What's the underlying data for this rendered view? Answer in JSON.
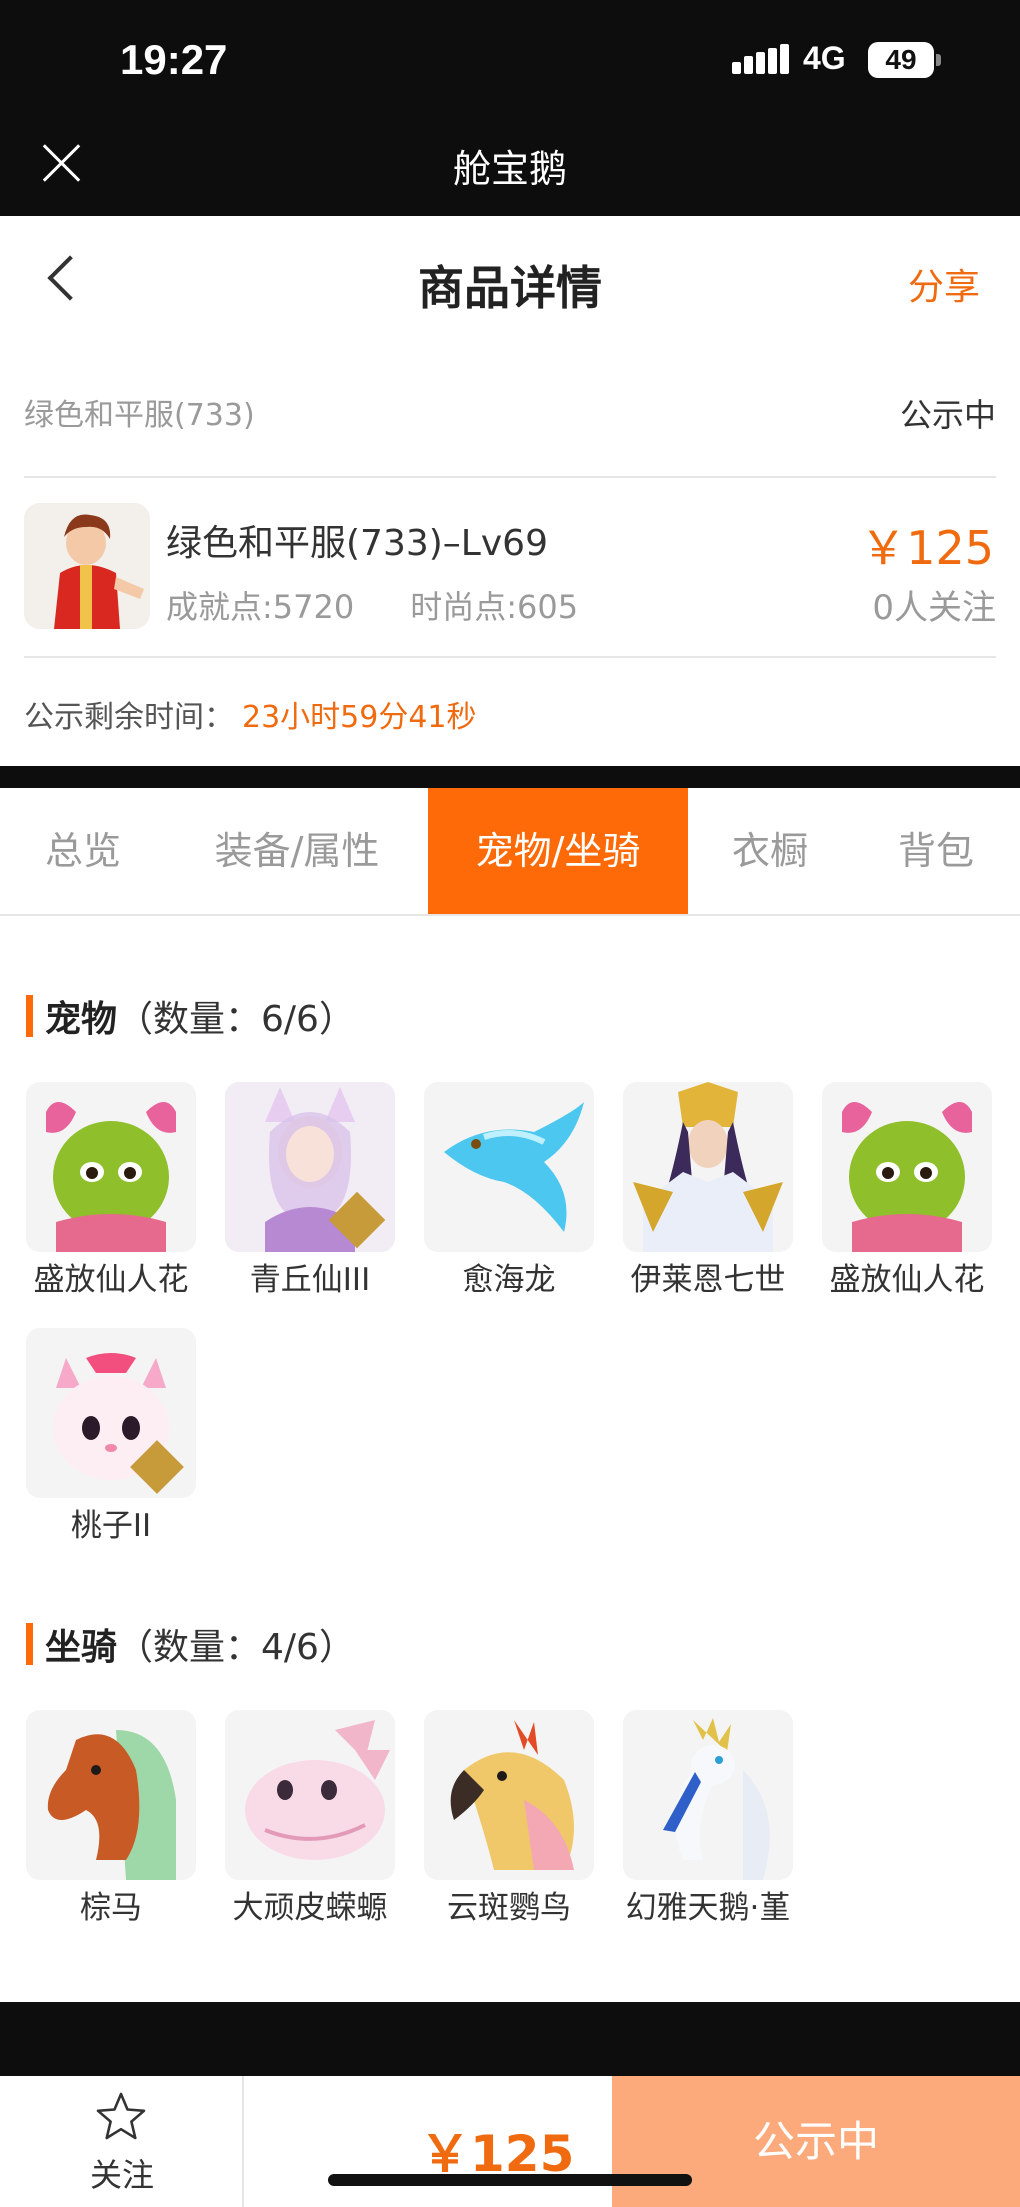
{
  "status_bar": {
    "time": "19:27",
    "network": "4G",
    "battery": "49"
  },
  "app_bar": {
    "title": "舱宝鹅"
  },
  "header": {
    "title": "商品详情",
    "share": "分享"
  },
  "product": {
    "server": "绿色和平服(733)",
    "status": "公示中",
    "title": "绿色和平服(733)–Lv69",
    "achievement": "成就点:5720",
    "fashion": "时尚点:605",
    "price": "￥125",
    "followers": "0人关注",
    "remaining_label": "公示剩余时间：",
    "remaining_value": "23小时59分41秒"
  },
  "tabs": [
    "总览",
    "装备/属性",
    "宠物/坐骑",
    "衣橱",
    "背包"
  ],
  "active_tab": "宠物/坐骑",
  "pets": {
    "title": "宠物",
    "count": "（数量：6/6）",
    "items": [
      {
        "name": "盛放仙人花",
        "icon": "cactus-flower-pet-icon"
      },
      {
        "name": "青丘仙III",
        "icon": "fox-fairy-pet-icon"
      },
      {
        "name": "愈海龙",
        "icon": "sea-dragon-pet-icon"
      },
      {
        "name": "伊莱恩七世",
        "icon": "queen-pet-icon"
      },
      {
        "name": "盛放仙人花",
        "icon": "cactus-flower-pet-icon"
      },
      {
        "name": "桃子II",
        "icon": "pink-cat-pet-icon"
      }
    ]
  },
  "mounts": {
    "title": "坐骑",
    "count": "（数量：4/6）",
    "items": [
      {
        "name": "棕马",
        "icon": "brown-horse-mount-icon"
      },
      {
        "name": "大顽皮蝾螈",
        "icon": "axolotl-mount-icon"
      },
      {
        "name": "云斑鹦鸟",
        "icon": "parrot-mount-icon"
      },
      {
        "name": "幻雅天鹅·堇",
        "icon": "swan-mount-icon"
      }
    ]
  },
  "bottom": {
    "follow": "关注",
    "price": "￥125",
    "status_button": "公示中"
  },
  "colors": {
    "accent": "#ff6a08",
    "price": "#f06a0f",
    "status_button": "#fcaa7c"
  }
}
